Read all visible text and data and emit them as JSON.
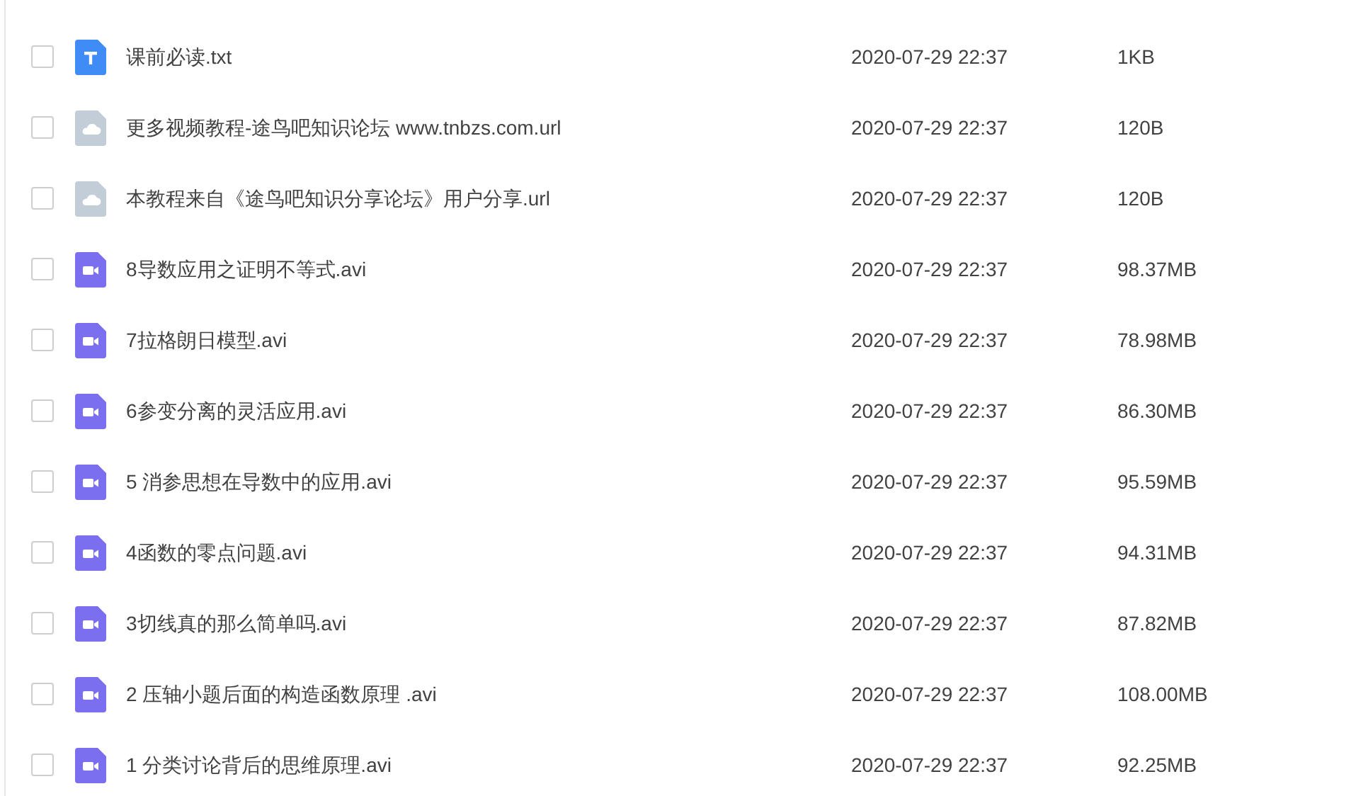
{
  "files": [
    {
      "kind": "text",
      "name": "课前必读.txt",
      "modified": "2020-07-29 22:37",
      "size": "1KB",
      "checked": false
    },
    {
      "kind": "link",
      "name": "更多视频教程-途鸟吧知识论坛 www.tnbzs.com.url",
      "modified": "2020-07-29 22:37",
      "size": "120B",
      "checked": false
    },
    {
      "kind": "link",
      "name": "本教程来自《途鸟吧知识分享论坛》用户分享.url",
      "modified": "2020-07-29 22:37",
      "size": "120B",
      "checked": false
    },
    {
      "kind": "video",
      "name": "8导数应用之证明不等式.avi",
      "modified": "2020-07-29 22:37",
      "size": "98.37MB",
      "checked": false
    },
    {
      "kind": "video",
      "name": "7拉格朗日模型.avi",
      "modified": "2020-07-29 22:37",
      "size": "78.98MB",
      "checked": false
    },
    {
      "kind": "video",
      "name": "6参变分离的灵活应用.avi",
      "modified": "2020-07-29 22:37",
      "size": "86.30MB",
      "checked": false
    },
    {
      "kind": "video",
      "name": "5 消参思想在导数中的应用.avi",
      "modified": "2020-07-29 22:37",
      "size": "95.59MB",
      "checked": false
    },
    {
      "kind": "video",
      "name": "4函数的零点问题.avi",
      "modified": "2020-07-29 22:37",
      "size": "94.31MB",
      "checked": false
    },
    {
      "kind": "video",
      "name": "3切线真的那么简单吗.avi",
      "modified": "2020-07-29 22:37",
      "size": "87.82MB",
      "checked": false
    },
    {
      "kind": "video",
      "name": "2 压轴小题后面的构造函数原理 .avi",
      "modified": "2020-07-29 22:37",
      "size": "108.00MB",
      "checked": false
    },
    {
      "kind": "video",
      "name": "1 分类讨论背后的思维原理.avi",
      "modified": "2020-07-29 22:37",
      "size": "92.25MB",
      "checked": false
    }
  ]
}
